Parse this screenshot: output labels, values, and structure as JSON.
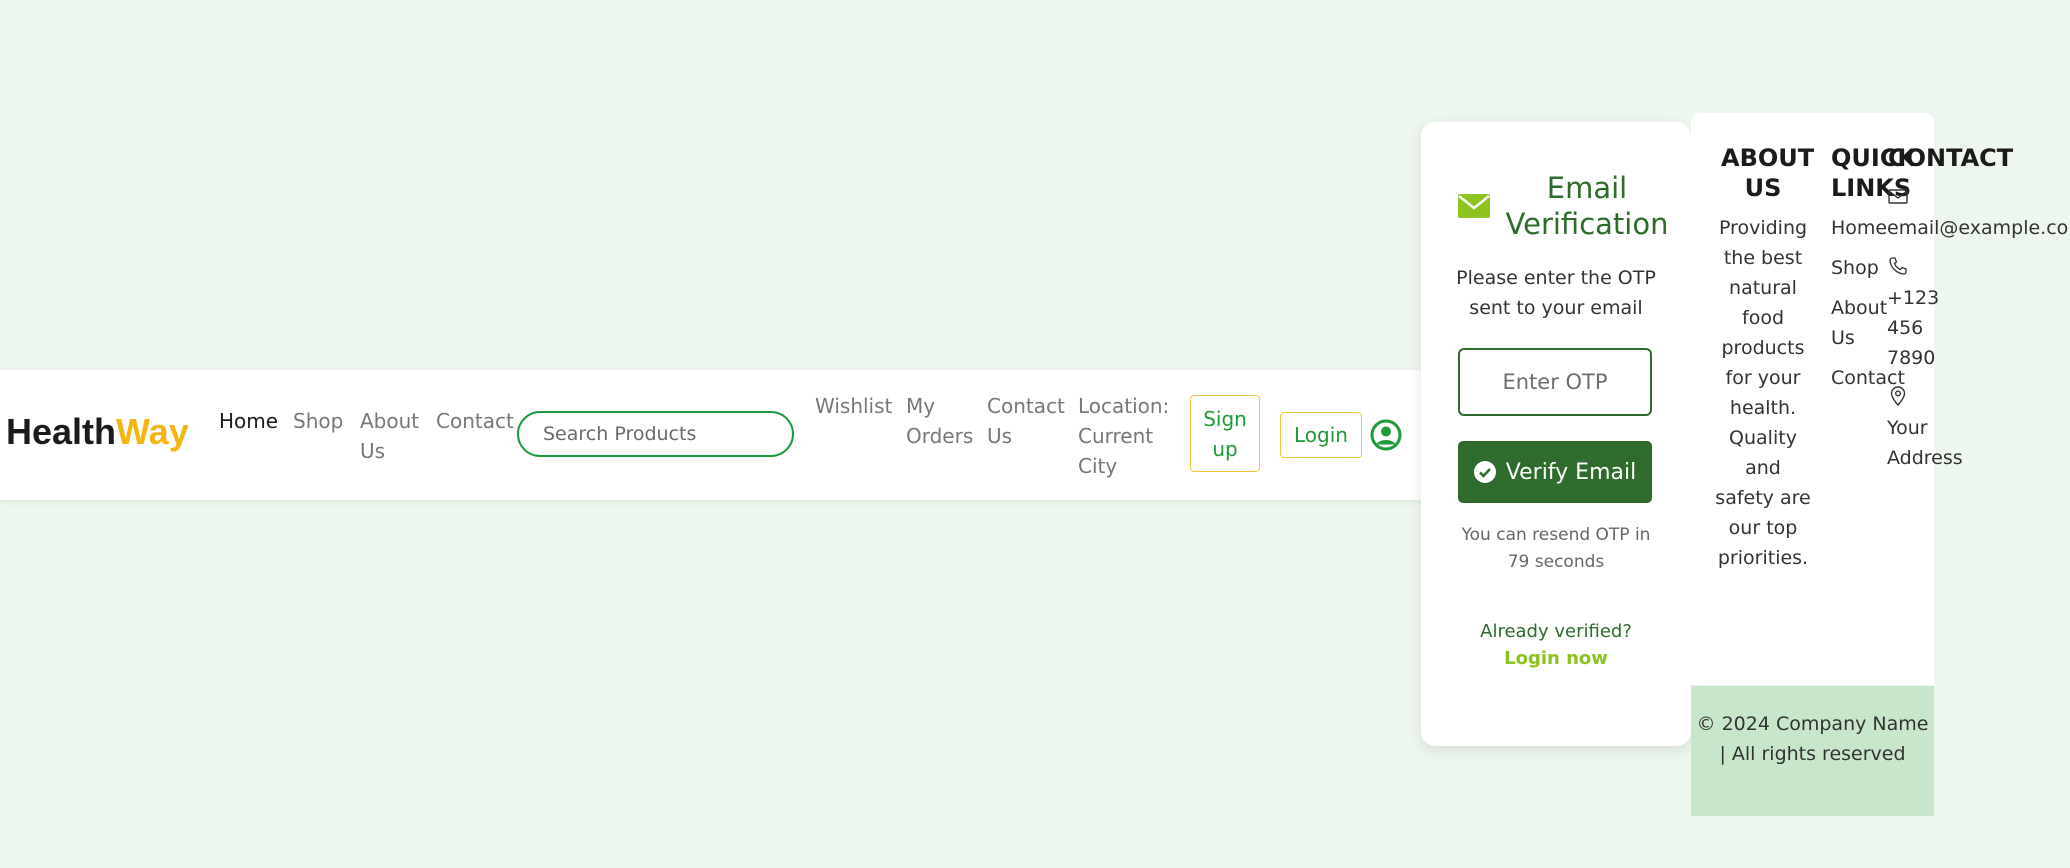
{
  "navbar": {
    "brand_part1": "Health",
    "brand_part2": "Way",
    "links": {
      "home": "Home",
      "shop": "Shop",
      "about_line1": "About",
      "about_line2": "Us",
      "contact": "Contact",
      "wishlist": "Wishlist",
      "orders_line1": "My",
      "orders_line2": "Orders",
      "contact_us_line1": "Contact",
      "contact_us_line2": "Us",
      "location_line1": "Location:",
      "location_line2": "Current",
      "location_line3": "City"
    },
    "search_placeholder": "Search Products",
    "signup_line1": "Sign",
    "signup_line2": "up",
    "login": "Login"
  },
  "verification": {
    "title_line1": "Email",
    "title_line2": "Verification",
    "subtitle": "Please enter the OTP sent to your email",
    "otp_placeholder": "Enter OTP",
    "verify_button": "Verify Email",
    "resend_text": "You can resend OTP in 79 seconds",
    "already_text": "Already verified?",
    "login_now": "Login now"
  },
  "footer": {
    "about_heading_line1": "ABOUT",
    "about_heading_line2": "US",
    "about_text": "Providing the best natural food products for your health. Quality and safety are our top priorities.",
    "quick_heading_line1": "QUICK",
    "quick_heading_line2": "LINKS",
    "quick_links": [
      "Home",
      "Shop",
      "About",
      "Us",
      "Contact"
    ],
    "contact_heading": "CONTACT",
    "email": "email@example.com",
    "phone_line1": "+123",
    "phone_line2": "456",
    "phone_line3": "7890",
    "address_line1": "Your",
    "address_line2": "Address",
    "copyright": "© 2024 Company Name | All rights reserved"
  },
  "colors": {
    "background": "#eef7ee",
    "primary_green": "#2e6b2c",
    "accent_yellow": "#f5b50f",
    "lime": "#8dc21f",
    "footer_bottom": "#c8e6c9"
  }
}
